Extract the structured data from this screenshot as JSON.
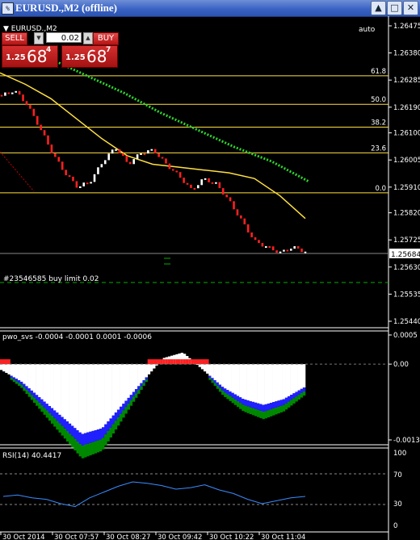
{
  "window": {
    "title": "EURUSD.,M2 (offline)",
    "minimize_glyph": "▲",
    "maximize_glyph": "□",
    "close_glyph": "✕"
  },
  "main_chart": {
    "symbol_label": "▼ EURUSD.,M2",
    "auto_label": "auto",
    "price_axis": [
      "1.26475",
      "1.26380",
      "1.26285",
      "1.26190",
      "1.26100",
      "1.26005",
      "1.25910",
      "1.25820",
      "1.25725",
      "1.25630",
      "1.25535",
      "1.25440"
    ],
    "current_price": "1.25684",
    "fib_levels": [
      "61.8",
      "50.0",
      "38.2",
      "23.6",
      "0.0"
    ],
    "order_label": "#23546585 buy limit 0.02"
  },
  "trade_panel": {
    "sell_label": "SELL",
    "buy_label": "BUY",
    "quantity": "0.02",
    "sell_price": {
      "prefix": "1.25",
      "big": "68",
      "sup": "4"
    },
    "buy_price": {
      "prefix": "1.25",
      "big": "68",
      "sup": "7"
    }
  },
  "pwo_indicator": {
    "label": "pwo_svs -0.0004 -0.0001 0.0001 -0.0006",
    "axis": [
      "0.0005",
      "0.00",
      "-0.0013"
    ]
  },
  "rsi_indicator": {
    "label": "RSI(14) 40.4417",
    "axis": [
      "100",
      "70",
      "30",
      "0"
    ]
  },
  "time_axis": [
    "30 Oct 2014",
    "30 Oct 07:57",
    "30 Oct 08:27",
    "30 Oct 09:42",
    "30 Oct 10:22",
    "30 Oct 11:04"
  ],
  "colors": {
    "bull_candle": "#ffffff",
    "bear_candle": "#ff2020",
    "moving_average": "#ffe040",
    "fast_ma": "#2bd82b",
    "fib_line": "#ffe040",
    "pwo_red": "#ff2020",
    "pwo_blue": "#2020ff",
    "pwo_green": "#008800",
    "rsi_line": "#3b8cff"
  },
  "chart_data": [
    {
      "type": "candlestick",
      "title": "EURUSD.,M2 (offline)",
      "ylim": [
        1.2544,
        1.26475
      ],
      "close_path": [
        1.2623,
        1.2625,
        1.262,
        1.2612,
        1.2603,
        1.2596,
        1.2591,
        1.2593,
        1.26,
        1.2605,
        1.2599,
        1.2603,
        1.2604,
        1.2599,
        1.2595,
        1.259,
        1.2594,
        1.2592,
        1.2586,
        1.2579,
        1.2572,
        1.257,
        1.2568,
        1.257,
        1.25684
      ],
      "ma_slow": [
        1.2631,
        1.2627,
        1.2622,
        1.2615,
        1.2608,
        1.2602,
        1.2599,
        1.2598,
        1.2597,
        1.2596,
        1.2594,
        1.2588,
        1.258
      ],
      "ma_fast": [
        1.2636,
        1.263,
        1.2624,
        1.2617,
        1.2611,
        1.2605,
        1.26,
        1.2593
      ],
      "fibonacci": [
        {
          "level": "61.8",
          "price": 1.263
        },
        {
          "level": "50.0",
          "price": 1.262
        },
        {
          "level": "38.2",
          "price": 1.2612
        },
        {
          "level": "23.6",
          "price": 1.2603
        },
        {
          "level": "0.0",
          "price": 1.2589
        }
      ],
      "current_price": 1.25684,
      "buy_limit": 1.256
    },
    {
      "type": "area",
      "title": "pwo_svs",
      "ylim": [
        -0.0013,
        0.0005
      ],
      "values": [
        -0.0001,
        -0.0003,
        -0.0006,
        -0.0009,
        -0.0012,
        -0.0011,
        -0.0007,
        -0.0003,
        0.0001,
        0.0002,
        -0.0001,
        -0.0004,
        -0.0006,
        -0.0007,
        -0.0006,
        -0.0004
      ]
    },
    {
      "type": "line",
      "title": "RSI(14)",
      "ylim": [
        0,
        100
      ],
      "levels": [
        70,
        30
      ],
      "values": [
        40,
        42,
        38,
        36,
        30,
        26,
        38,
        46,
        54,
        60,
        58,
        55,
        50,
        52,
        56,
        49,
        44,
        36,
        30,
        34,
        38,
        40
      ]
    }
  ]
}
